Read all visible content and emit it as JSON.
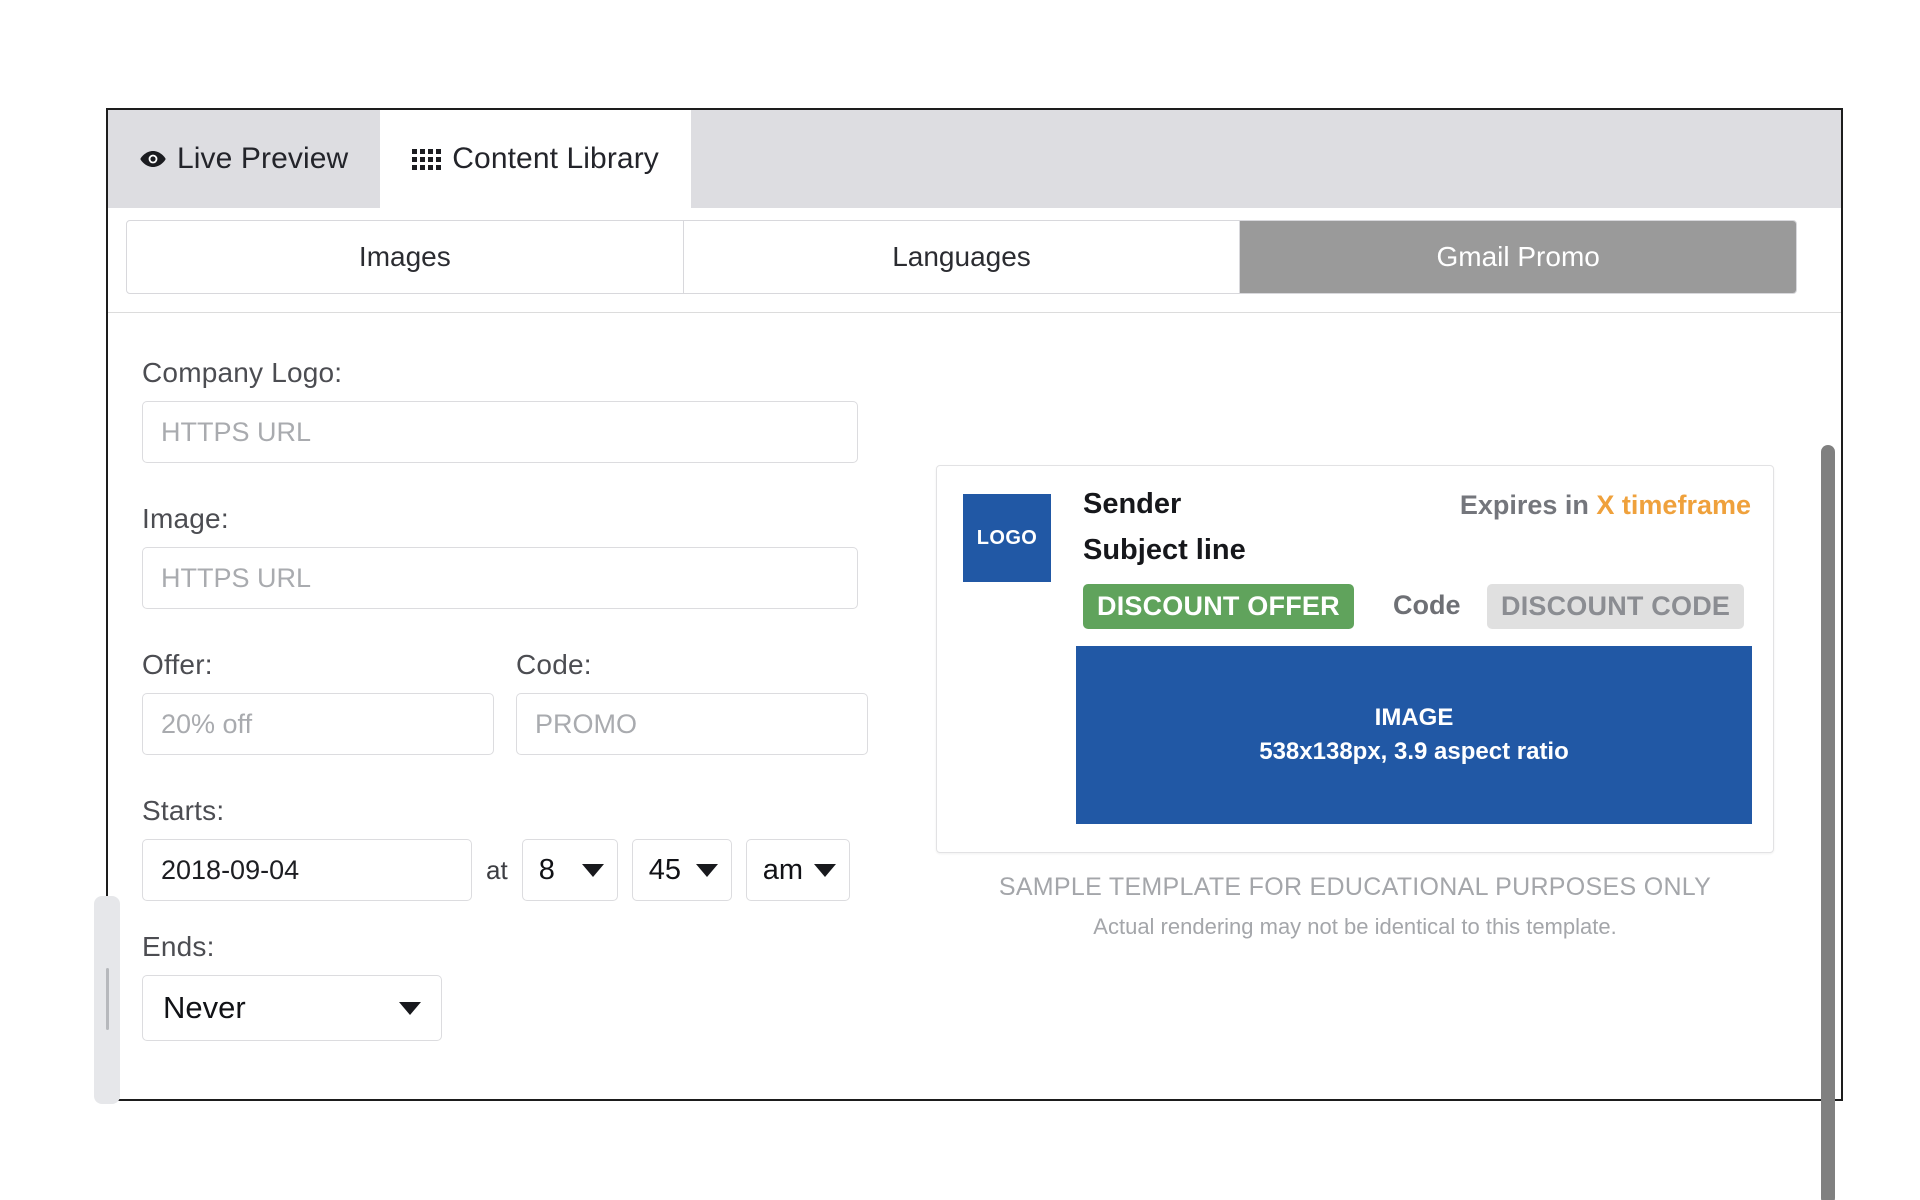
{
  "window": {
    "tabs": [
      {
        "label": "Live Preview",
        "icon": "eye-icon",
        "active": false
      },
      {
        "label": "Content Library",
        "icon": "grid-icon",
        "active": true
      }
    ]
  },
  "segmented": {
    "options": [
      {
        "label": "Images",
        "selected": false
      },
      {
        "label": "Languages",
        "selected": false
      },
      {
        "label": "Gmail Promo",
        "selected": true
      }
    ]
  },
  "form": {
    "company_logo": {
      "label": "Company Logo:",
      "placeholder": "HTTPS URL",
      "value": ""
    },
    "image": {
      "label": "Image:",
      "placeholder": "HTTPS URL",
      "value": ""
    },
    "offer": {
      "label": "Offer:",
      "placeholder": "20% off",
      "value": ""
    },
    "code": {
      "label": "Code:",
      "placeholder": "PROMO",
      "value": ""
    },
    "starts": {
      "label": "Starts:",
      "date_value": "2018-09-04",
      "at_word": "at",
      "hour": "8",
      "minute": "45",
      "meridiem": "am"
    },
    "ends": {
      "label": "Ends:",
      "value": "Never"
    }
  },
  "preview": {
    "logo_text": "LOGO",
    "sender": "Sender",
    "subject": "Subject line",
    "expires_prefix": "Expires in",
    "expires_value": "X timeframe",
    "offer_badge": "DISCOUNT OFFER",
    "code_word": "Code",
    "code_badge": "DISCOUNT CODE",
    "image_label": "IMAGE",
    "image_spec": "538x138px, 3.9 aspect ratio",
    "disclaimer_line1": "SAMPLE TEMPLATE FOR EDUCATIONAL PURPOSES ONLY",
    "disclaimer_line2": "Actual rendering may not be identical to this template."
  },
  "colors": {
    "tab_inactive_bg": "#dddde1",
    "segment_selected_bg": "#9a9a9a",
    "brand_blue": "#2158a5",
    "offer_green": "#60a35c",
    "code_gray": "#e0e0e0",
    "expires_accent": "#efa13c",
    "scrollbar_thumb": "#808080"
  }
}
